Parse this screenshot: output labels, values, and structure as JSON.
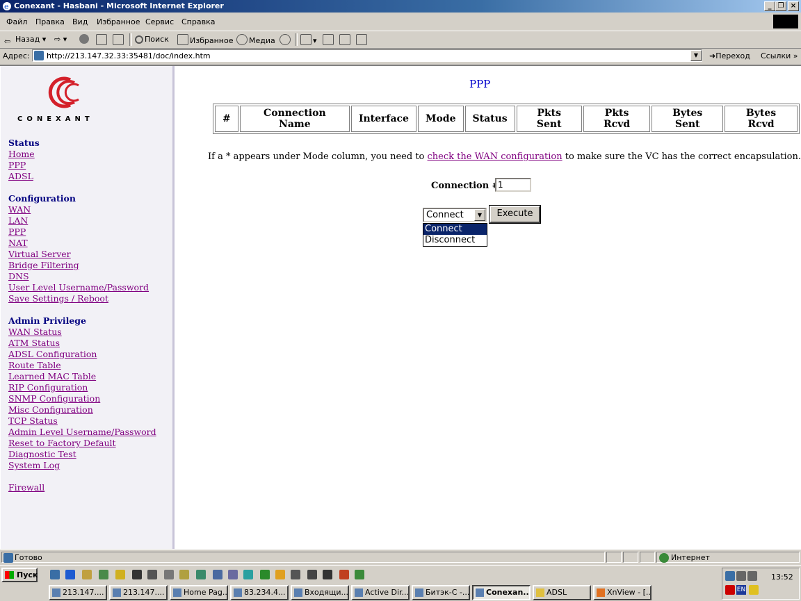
{
  "window": {
    "title": "Conexant - Hasbani - Microsoft Internet Explorer"
  },
  "menu": [
    "Файл",
    "Правка",
    "Вид",
    "Избранное",
    "Сервис",
    "Справка"
  ],
  "toolbar": {
    "back": "Назад",
    "search": "Поиск",
    "favorites": "Избранное",
    "media": "Медиа"
  },
  "address": {
    "label": "Адрес:",
    "url": "http://213.147.32.33:35481/doc/index.htm",
    "go": "Переход",
    "links": "Ссылки"
  },
  "sidebar": {
    "logo_text": "CONEXANT",
    "status": {
      "heading": "Status",
      "links": [
        "Home",
        "PPP",
        "ADSL"
      ]
    },
    "configuration": {
      "heading": "Configuration",
      "links": [
        "WAN",
        "LAN",
        "PPP",
        "NAT",
        "Virtual Server",
        "Bridge Filtering",
        "DNS",
        "User Level Username/Password",
        "Save Settings / Reboot"
      ]
    },
    "admin": {
      "heading": "Admin Privilege",
      "links": [
        "WAN Status",
        "ATM Status",
        "ADSL Configuration",
        "Route Table",
        "Learned MAC Table",
        "RIP Configuration",
        "SNMP Configuration",
        "Misc Configuration",
        "TCP Status",
        "Admin Level Username/Password",
        "Reset to Factory Default",
        "Diagnostic Test",
        "System Log"
      ]
    },
    "firewall": "Firewall"
  },
  "main": {
    "title": "PPP",
    "table_headers": [
      "#",
      "Connection Name",
      "Interface",
      "Mode",
      "Status",
      "Pkts Sent",
      "Pkts Rcvd",
      "Bytes Sent",
      "Bytes Rcvd"
    ],
    "note_before": "If a * appears under Mode column, you need to ",
    "note_link": "check the WAN configuration",
    "note_after": " to make sure the VC has the correct encapsulation.",
    "connection_label": "Connection #",
    "connection_value": "1",
    "select_value": "Connect",
    "select_options": [
      "Connect",
      "Disconnect"
    ],
    "execute": "Execute"
  },
  "status": {
    "left": "Готово",
    "zone": "Интернет"
  },
  "taskbar": {
    "start": "Пуск",
    "tasks": [
      "213.147....",
      "213.147....",
      "Home Pag...",
      "83.234.4...",
      "Входящи...",
      "Active Dir...",
      "Битэк-С -...",
      "Conexan...",
      "ADSL",
      "XnView - [..."
    ],
    "clock": "13:52",
    "lang": "EN"
  }
}
